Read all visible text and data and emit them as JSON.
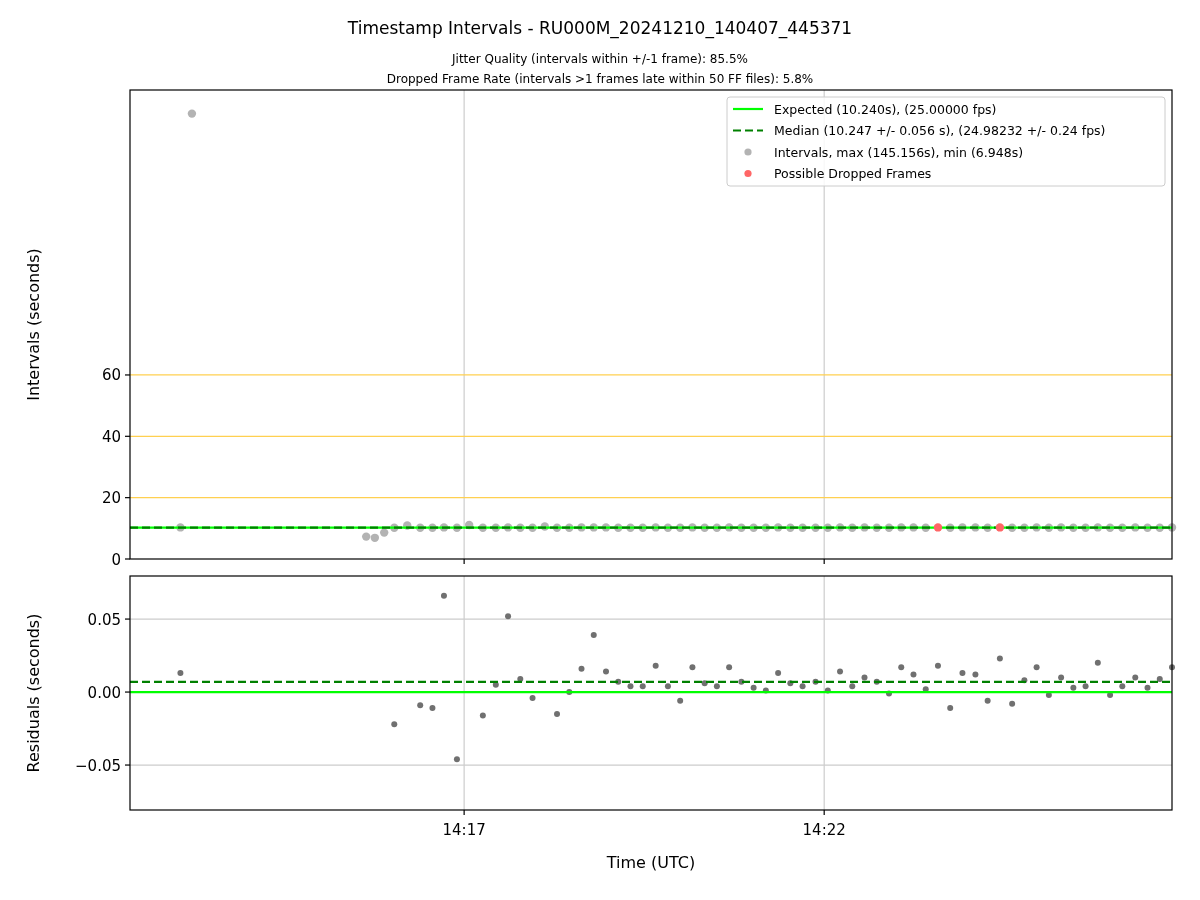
{
  "figure": {
    "title": "Timestamp Intervals - RU000M_20241210_140407_445371",
    "subtitles": [
      "Jitter Quality (intervals within +/-1 frame): 85.5%",
      "Dropped Frame Rate (intervals >1 frames late within 50 FF files): 5.8%"
    ]
  },
  "charts": [
    {
      "kind": "intervals",
      "chart_data": {
        "type": "scatter",
        "grid": true,
        "legend": "upper right",
        "ylabel": "Intervals (seconds)",
        "xlim": [
          852.36,
          866.83
        ],
        "ylim": [
          0,
          152.9
        ],
        "yticks": [
          {
            "value": 0,
            "label": "0"
          },
          {
            "value": 20,
            "label": "20"
          },
          {
            "value": 40,
            "label": "40"
          },
          {
            "value": 60,
            "label": "60"
          }
        ],
        "ref_lines": [
          {
            "axis": "y",
            "value": 10.24,
            "label": "Expected (10.240s), (25.00000 fps)",
            "color": "#00ff00"
          },
          {
            "axis": "y",
            "value": 10.247,
            "label": "Median (10.247 +/- 0.056 s), (24.98232 +/- 0.24 fps)",
            "color": "#008000"
          }
        ],
        "series": [
          {
            "name": "Intervals, max (145.156s), min (6.948s)",
            "color": "#b3b3b3",
            "x": [
              853.06,
              853.22,
              855.64,
              855.76,
              855.89,
              856.03,
              856.21,
              856.39,
              856.56,
              856.72,
              856.9,
              857.07,
              857.26,
              857.44,
              857.61,
              857.78,
              857.95,
              858.12,
              858.29,
              858.46,
              858.63,
              858.8,
              858.97,
              859.14,
              859.31,
              859.48,
              859.66,
              859.83,
              860.0,
              860.17,
              860.34,
              860.51,
              860.68,
              860.85,
              861.02,
              861.19,
              861.36,
              861.53,
              861.7,
              861.88,
              862.05,
              862.22,
              862.39,
              862.56,
              862.73,
              862.9,
              863.07,
              863.24,
              863.41,
              863.75,
              863.92,
              864.1,
              864.27,
              864.61,
              864.78,
              864.95,
              865.12,
              865.29,
              865.46,
              865.63,
              865.8,
              865.97,
              866.14,
              866.32,
              866.49,
              866.66,
              866.83
            ],
            "values": [
              10.3,
              145.2,
              7.3,
              6.9,
              8.6,
              10.2,
              10.9,
              10.2,
              10.2,
              10.3,
              10.2,
              11.1,
              10.2,
              10.2,
              10.3,
              10.2,
              10.2,
              10.6,
              10.2,
              10.2,
              10.3,
              10.3,
              10.3,
              10.2,
              10.2,
              10.2,
              10.3,
              10.2,
              10.2,
              10.3,
              10.2,
              10.2,
              10.3,
              10.2,
              10.2,
              10.2,
              10.3,
              10.2,
              10.2,
              10.2,
              10.2,
              10.3,
              10.2,
              10.3,
              10.2,
              10.2,
              10.3,
              10.3,
              10.2,
              10.2,
              10.3,
              10.3,
              10.2,
              10.2,
              10.2,
              10.3,
              10.2,
              10.3,
              10.2,
              10.2,
              10.3,
              10.2,
              10.2,
              10.3,
              10.2,
              10.2,
              10.3
            ]
          },
          {
            "name": "Possible Dropped Frames",
            "color": "#ff6666",
            "x": [
              863.58,
              864.44
            ],
            "values": [
              10.3,
              10.3
            ]
          }
        ]
      }
    },
    {
      "kind": "residuals",
      "chart_data": {
        "type": "scatter",
        "grid": true,
        "xlabel": "Time (UTC)",
        "ylabel": "Residuals (seconds)",
        "xlim": [
          852.36,
          866.83
        ],
        "ylim": [
          -0.0808,
          0.0795
        ],
        "xticks": [
          {
            "value": 857,
            "label": "14:17"
          },
          {
            "value": 862,
            "label": "14:22"
          }
        ],
        "yticks": [
          {
            "value": -0.05,
            "label": "−0.05"
          },
          {
            "value": 0,
            "label": "0.00"
          },
          {
            "value": 0.05,
            "label": "0.05"
          }
        ],
        "ref_lines": [
          {
            "axis": "y",
            "value": 0,
            "color": "#00ff00"
          },
          {
            "axis": "y",
            "value": 0.007,
            "color": "#008000"
          }
        ],
        "series": [
          {
            "color": "#707070",
            "x": [
              853.06,
              856.03,
              856.39,
              856.56,
              856.72,
              856.9,
              857.26,
              857.44,
              857.61,
              857.78,
              857.95,
              858.29,
              858.46,
              858.63,
              858.8,
              858.97,
              859.14,
              859.31,
              859.48,
              859.66,
              859.83,
              860.0,
              860.17,
              860.34,
              860.51,
              860.68,
              860.85,
              861.02,
              861.19,
              861.36,
              861.53,
              861.7,
              861.88,
              862.05,
              862.22,
              862.39,
              862.56,
              862.73,
              862.9,
              863.07,
              863.24,
              863.41,
              863.58,
              863.75,
              863.92,
              864.1,
              864.27,
              864.44,
              864.61,
              864.78,
              864.95,
              865.12,
              865.29,
              865.46,
              865.63,
              865.8,
              865.97,
              866.14,
              866.32,
              866.49,
              866.66,
              866.83
            ],
            "values": [
              0.013,
              -0.022,
              -0.009,
              -0.011,
              0.066,
              -0.046,
              -0.016,
              0.005,
              0.052,
              0.009,
              -0.004,
              -0.015,
              0.0,
              0.016,
              0.039,
              0.014,
              0.007,
              0.004,
              0.004,
              0.018,
              0.004,
              -0.006,
              0.017,
              0.006,
              0.004,
              0.017,
              0.007,
              0.003,
              0.001,
              0.013,
              0.006,
              0.004,
              0.007,
              0.001,
              0.014,
              0.004,
              0.01,
              0.007,
              -0.001,
              0.017,
              0.012,
              0.002,
              0.018,
              -0.011,
              0.013,
              0.012,
              -0.006,
              0.023,
              -0.008,
              0.008,
              0.017,
              -0.002,
              0.01,
              0.003,
              0.004,
              0.02,
              -0.002,
              0.004,
              0.01,
              0.003,
              0.009,
              0.017
            ]
          }
        ]
      }
    }
  ]
}
